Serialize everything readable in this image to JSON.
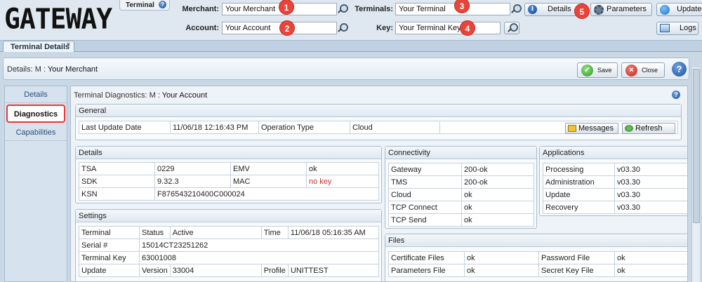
{
  "app": {
    "logo": "GATEWAY"
  },
  "header": {
    "terminal_chip": "Terminal",
    "help_glyph": "?",
    "merchant_label": "Merchant:",
    "merchant_value": "Your Merchant",
    "account_label": "Account:",
    "account_value": "Your Account",
    "terminals_label": "Terminals:",
    "terminals_value": "Your Terminal",
    "key_label": "Key:",
    "key_value": "Your Terminal Key",
    "badges": [
      "1",
      "2",
      "3",
      "4",
      "5"
    ],
    "buttons": {
      "details": "Details",
      "parameters": "Parameters",
      "update": "Update",
      "logs": "Logs"
    }
  },
  "tabs": [
    {
      "label": "Terminal Details",
      "close": "×"
    }
  ],
  "details_bar": {
    "prefix": "Details: M : ",
    "merchant": "Your Merchant",
    "save": "Save",
    "close": "Close"
  },
  "nav": [
    {
      "label": "Details"
    },
    {
      "label": "Diagnostics"
    },
    {
      "label": "Capabilities"
    }
  ],
  "main": {
    "title_prefix": "Terminal Diagnostics: M : ",
    "title_account": "Your Account",
    "general": {
      "title": "General",
      "row": [
        "Last Update Date",
        "11/06/18 12:16:43 PM",
        "Operation Type",
        "Cloud"
      ],
      "messages_button": "Messages",
      "refresh_button": "Refresh"
    },
    "details": {
      "title": "Details",
      "rows": [
        [
          "TSA",
          "0229",
          "EMV",
          "ok"
        ],
        [
          "SDK",
          "9.32.3",
          "MAC",
          "no key"
        ],
        [
          "KSN",
          "F876543210400C000024",
          "",
          ""
        ]
      ]
    },
    "connectivity": {
      "title": "Connectivity",
      "rows": [
        [
          "Gateway",
          "200-ok"
        ],
        [
          "TMS",
          "200-ok"
        ],
        [
          "Cloud",
          "ok"
        ],
        [
          "TCP Connect",
          "ok"
        ],
        [
          "TCP Send",
          "ok"
        ]
      ]
    },
    "applications": {
      "title": "Applications",
      "rows": [
        [
          "Processing",
          "v03.30"
        ],
        [
          "Administration",
          "v03.30"
        ],
        [
          "Update",
          "v03.30"
        ],
        [
          "Recovery",
          "v03.30"
        ]
      ]
    },
    "settings": {
      "title": "Settings",
      "row1": [
        "Terminal",
        "Status",
        "Active",
        "Time",
        "11/06/18 05:16:35 AM"
      ],
      "row2": [
        "Serial #",
        "15014CT23251262"
      ],
      "row3": [
        "Terminal Key",
        "63001008"
      ],
      "row4": [
        "Update",
        "Version",
        "33004",
        "Profile",
        "UNITTEST"
      ]
    },
    "files": {
      "title": "Files",
      "rows": [
        [
          "Certificate Files",
          "ok",
          "Password File",
          "ok"
        ],
        [
          "Parameters File",
          "ok",
          "Secret Key File",
          "ok"
        ]
      ]
    }
  },
  "colors": {
    "badge": "#e9443a",
    "accent_text": "#d32f2f",
    "highlight_border": "#e53935"
  }
}
